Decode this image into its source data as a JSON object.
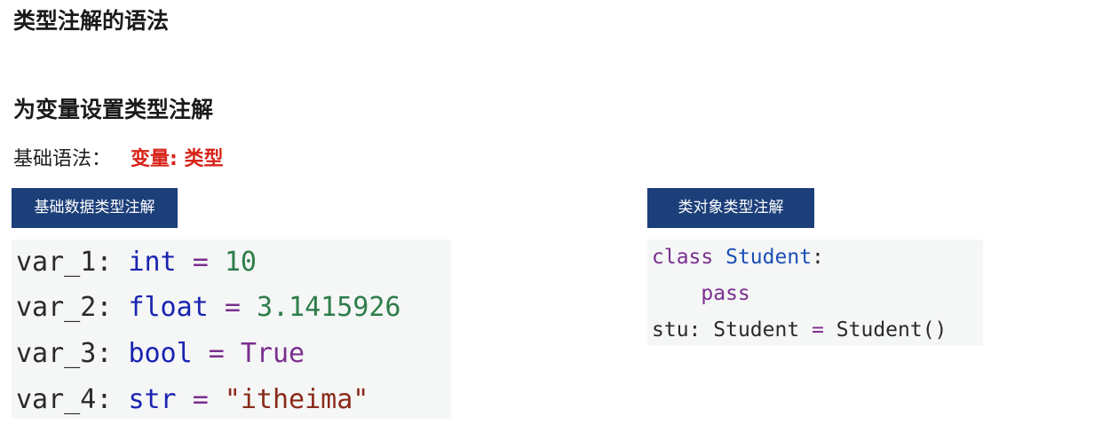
{
  "page_title": "类型注解的语法",
  "section_title": "为变量设置类型注解",
  "syntax": {
    "label": "基础语法：",
    "value": "变量: 类型"
  },
  "basic_block": {
    "tag_label": "基础数据类型注解",
    "lines": [
      {
        "name": "var_1",
        "colon": ":",
        "type": "int",
        "eq": "=",
        "value": "10",
        "value_kind": "number"
      },
      {
        "name": "var_2",
        "colon": ":",
        "type": "float",
        "eq": "=",
        "value": "3.1415926",
        "value_kind": "number"
      },
      {
        "name": "var_3",
        "colon": ":",
        "type": "bool",
        "eq": "=",
        "value": "True",
        "value_kind": "constant"
      },
      {
        "name": "var_4",
        "colon": ":",
        "type": "str",
        "eq": "=",
        "value": "\"itheima\"",
        "value_kind": "string"
      }
    ]
  },
  "class_block": {
    "tag_label": "类对象类型注解",
    "line1": {
      "keyword": "class",
      "class_name": "Student",
      "colon": ":"
    },
    "line2": {
      "keyword": "pass"
    },
    "line3": {
      "name": "stu",
      "colon": ":",
      "type": "Student",
      "eq": "=",
      "call": "Student()"
    }
  },
  "colors": {
    "tag_background": "#1c3f7a",
    "syntax_highlight": "#d8231a",
    "code_background": "#f5f6f6"
  }
}
